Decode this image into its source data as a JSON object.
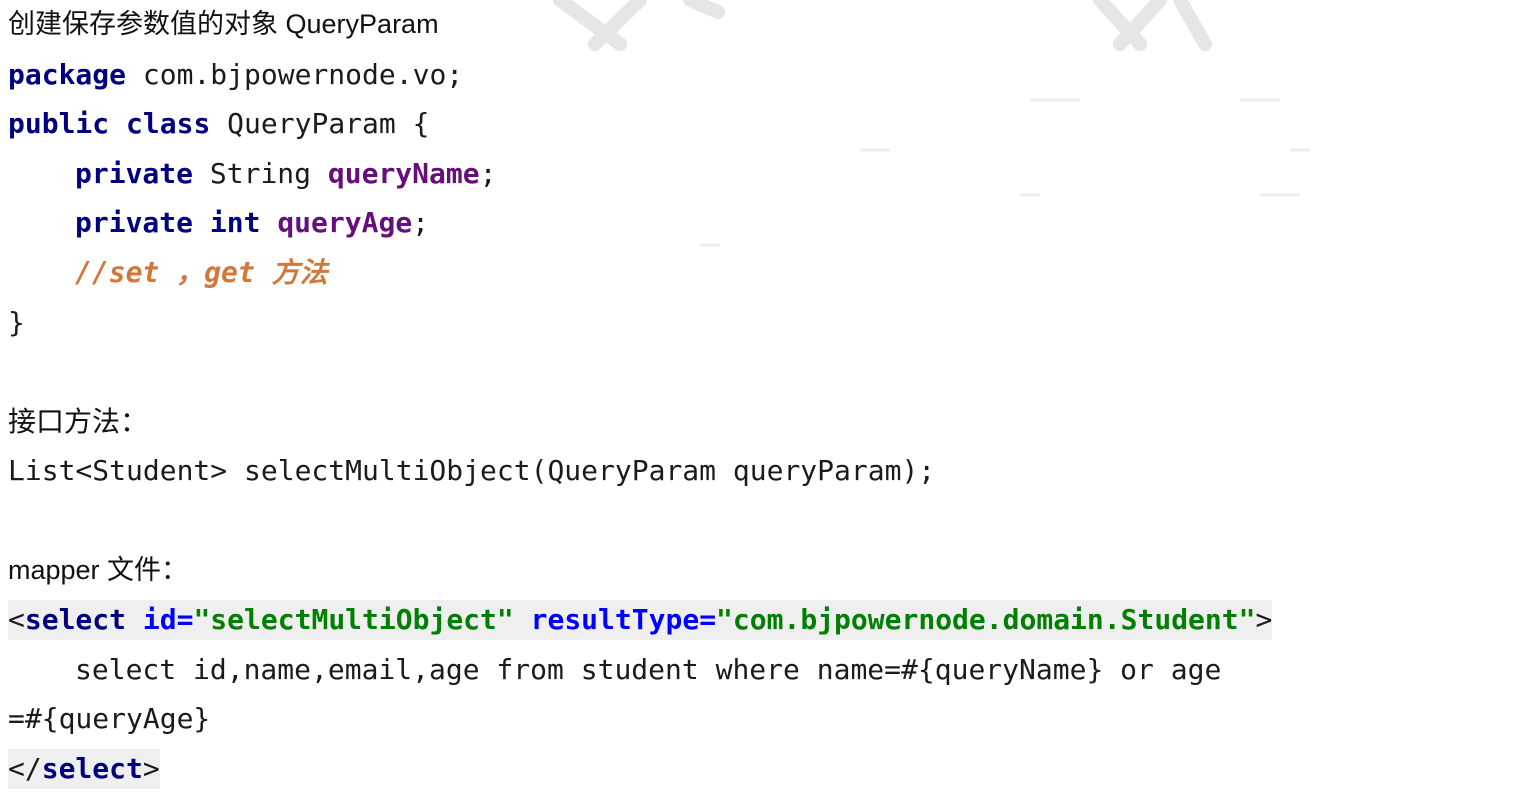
{
  "heading": {
    "prefix": "创建保存参数值的对象",
    "class_name": "QueryParam"
  },
  "java": {
    "package_kw": "package",
    "package_name": " com.bjpowernode.vo;",
    "class_kw1": "public",
    "class_kw2": "class",
    "class_name": " QueryParam {",
    "field1_kw": "private",
    "field1_type": " String ",
    "field1_name": "queryName",
    "field1_end": ";",
    "field2_kw": "private",
    "field2_type": "int",
    "field2_name": "queryAge",
    "field2_end": ";",
    "comment": "//set ，get 方法",
    "close_brace": "}"
  },
  "interface_section": {
    "label": "接口方法：",
    "signature": "List<Student> selectMultiObject(QueryParam queryParam);"
  },
  "mapper_section": {
    "label": "mapper 文件：",
    "open_lt": "<",
    "tag_name": "select",
    "attr1_name": "id",
    "attr1_eq": "=",
    "attr1_value": "\"selectMultiObject\"",
    "attr2_name": "resultType",
    "attr2_eq": "=",
    "attr2_value": "\"com.bjpowernode.domain.Student\"",
    "open_gt": ">",
    "sql_line1": "select id,name,email,age from student where name=#{queryName} or age",
    "sql_line2": "=#{queryAge}",
    "close_lt": "</",
    "close_tag_name": "select",
    "close_gt": ">"
  }
}
